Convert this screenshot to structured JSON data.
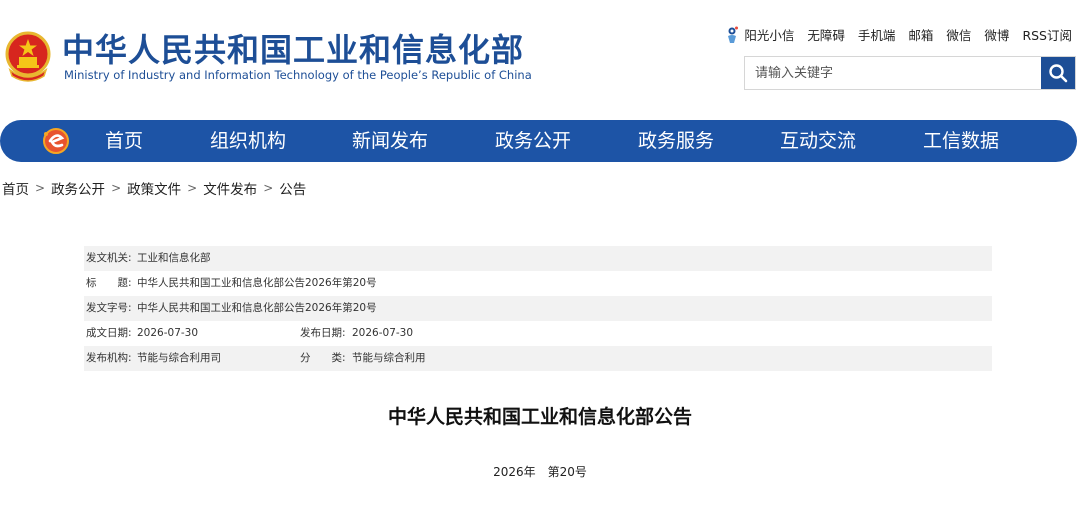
{
  "header": {
    "brand_cn": "中华人民共和国工业和信息化部",
    "brand_en": "Ministry of Industry and Information Technology of the People’s Republic of China",
    "top_links": [
      "阳光小信",
      "无障碍",
      "手机端",
      "邮箱",
      "微信",
      "微博",
      "RSS订阅"
    ],
    "search_placeholder": "请输入关键字"
  },
  "nav": {
    "items": [
      "首页",
      "组织机构",
      "新闻发布",
      "政务公开",
      "政务服务",
      "互动交流",
      "工信数据"
    ]
  },
  "breadcrumb": [
    "首页",
    "政务公开",
    "政策文件",
    "文件发布",
    "公告"
  ],
  "breadcrumb_separator": ">",
  "meta": {
    "issuer_label": "发文机关:",
    "issuer": "工业和信息化部",
    "title_label": "标　　题:",
    "title": "中华人民共和国工业和信息化部公告2026年第20号",
    "doc_no_label": "发文字号:",
    "doc_no": "中华人民共和国工业和信息化部公告2026年第20号",
    "created_label": "成文日期:",
    "created": "2026-07-30",
    "published_label": "发布日期:",
    "published": "2026-07-30",
    "org_label": "发布机构:",
    "org": "节能与综合利用司",
    "category_label": "分　　类:",
    "category": "节能与综合利用"
  },
  "document": {
    "title": "中华人民共和国工业和信息化部公告",
    "number": "2026年　第20号"
  },
  "colors": {
    "brand_blue": "#1d4e96",
    "nav_blue": "#1d54a6",
    "meta_shade": "#f2f2f2"
  },
  "icons": {
    "emblem": "national-emblem-icon",
    "sun": "sunshine-icon",
    "search": "search-icon",
    "nav_logo": "ministry-logo-icon"
  }
}
